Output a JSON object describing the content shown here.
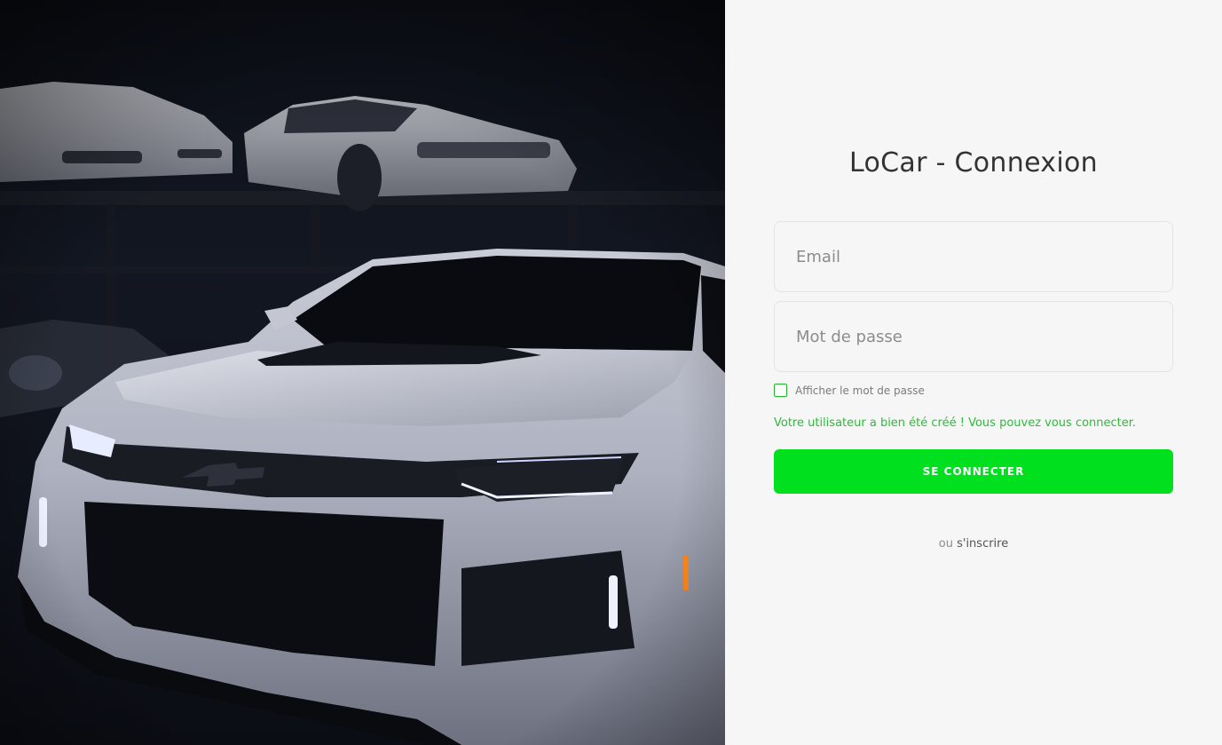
{
  "hero": {
    "image_description_icon": "sports-car-photo"
  },
  "login": {
    "title": "LoCar - Connexion",
    "email_placeholder": "Email",
    "email_value": "",
    "password_placeholder": "Mot de passe",
    "password_value": "",
    "show_password_label": "Afficher le mot de passe",
    "show_password_checked": false,
    "success_message": "Votre utilisateur a bien été créé ! Vous pouvez vous connecter.",
    "submit_label": "SE CONNECTER",
    "alt_prefix": "ou",
    "register_link": "s'inscrire"
  },
  "colors": {
    "accent": "#00e01e",
    "success_text": "#2dbb3a",
    "title_text": "#333333",
    "panel_bg": "#f6f6f6"
  }
}
